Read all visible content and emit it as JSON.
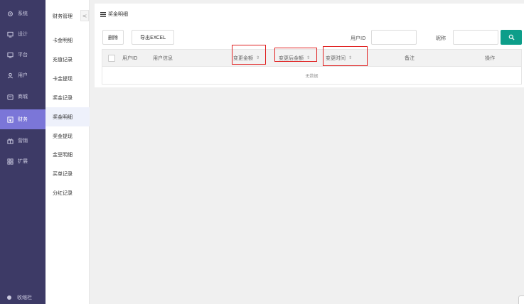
{
  "nav": {
    "items": [
      {
        "label": "系统",
        "icon": "gear-icon"
      },
      {
        "label": "设计",
        "icon": "monitor-icon"
      },
      {
        "label": "平台",
        "icon": "monitor-icon"
      },
      {
        "label": "用户",
        "icon": "user-icon"
      },
      {
        "label": "商城",
        "icon": "shop-icon"
      },
      {
        "label": "财务",
        "icon": "finance-icon"
      },
      {
        "label": "营销",
        "icon": "gift-icon"
      },
      {
        "label": "扩展",
        "icon": "grid-icon"
      }
    ],
    "active_index": 5,
    "footer_label": "收缩栏"
  },
  "subnav": {
    "title": "财务管理",
    "collapse_glyph": "<",
    "items": [
      "卡金明细",
      "充值记录",
      "卡金提现",
      "奖金记录",
      "奖金明细",
      "奖金提现",
      "金豆明细",
      "买单记录",
      "分红记录"
    ],
    "active_index": 4
  },
  "card": {
    "title": "奖金明细",
    "delete_label": "删除",
    "export_label": "导出EXCEL",
    "userid_label": "用户ID",
    "userid_value": "",
    "nickname_label": "昵称",
    "nickname_value": "",
    "search_icon": "search-icon"
  },
  "table": {
    "columns": [
      "用户ID",
      "用户信息",
      "变更金额",
      "变更后金额",
      "变更时间",
      "备注",
      "操作"
    ],
    "sort_glyph": "⇕",
    "empty_text": "无数据"
  },
  "colors": {
    "nav_bg": "#3d3a66",
    "nav_active": "#7b76d8",
    "search_btn": "#0d9e8a",
    "highlight_box": "#e02020"
  }
}
